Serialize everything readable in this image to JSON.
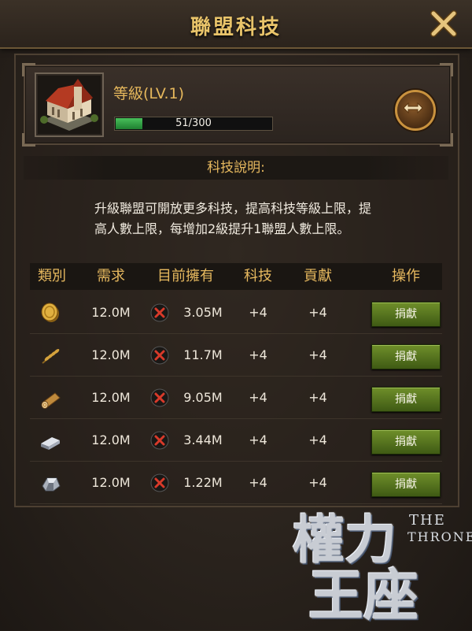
{
  "header": {
    "title": "聯盟科技"
  },
  "level": {
    "label": "等級(LV.1)",
    "progress_text": "51/300",
    "progress_fraction": 0.17
  },
  "description": {
    "title": "科技說明:",
    "text": "升級聯盟可開放更多科技，提高科技等級上限，提高人數上限，每增加2級提升1聯盟人數上限。"
  },
  "table": {
    "headers": [
      "類別",
      "需求",
      "目前擁有",
      "科技",
      "貢獻",
      "操作"
    ],
    "rows": [
      {
        "icon": "gold-coin-icon",
        "requirement": "12.0M",
        "owned": "3.05M",
        "tech": "+4",
        "contribution": "+4",
        "action": "捐獻"
      },
      {
        "icon": "wheat-icon",
        "requirement": "12.0M",
        "owned": "11.7M",
        "tech": "+4",
        "contribution": "+4",
        "action": "捐獻"
      },
      {
        "icon": "wood-log-icon",
        "requirement": "12.0M",
        "owned": "9.05M",
        "tech": "+4",
        "contribution": "+4",
        "action": "捐獻"
      },
      {
        "icon": "iron-bar-icon",
        "requirement": "12.0M",
        "owned": "3.44M",
        "tech": "+4",
        "contribution": "+4",
        "action": "捐獻"
      },
      {
        "icon": "stone-ore-icon",
        "requirement": "12.0M",
        "owned": "1.22M",
        "tech": "+4",
        "contribution": "+4",
        "action": "捐獻"
      }
    ]
  },
  "logo": {
    "cn_line1": "權力",
    "cn_line2": "王座",
    "en_line1": "THE",
    "en_line2": "THRONE"
  },
  "colors": {
    "accent": "#e7b95f",
    "button_green": "#5a7a20",
    "progress_green": "#3fae4f"
  }
}
